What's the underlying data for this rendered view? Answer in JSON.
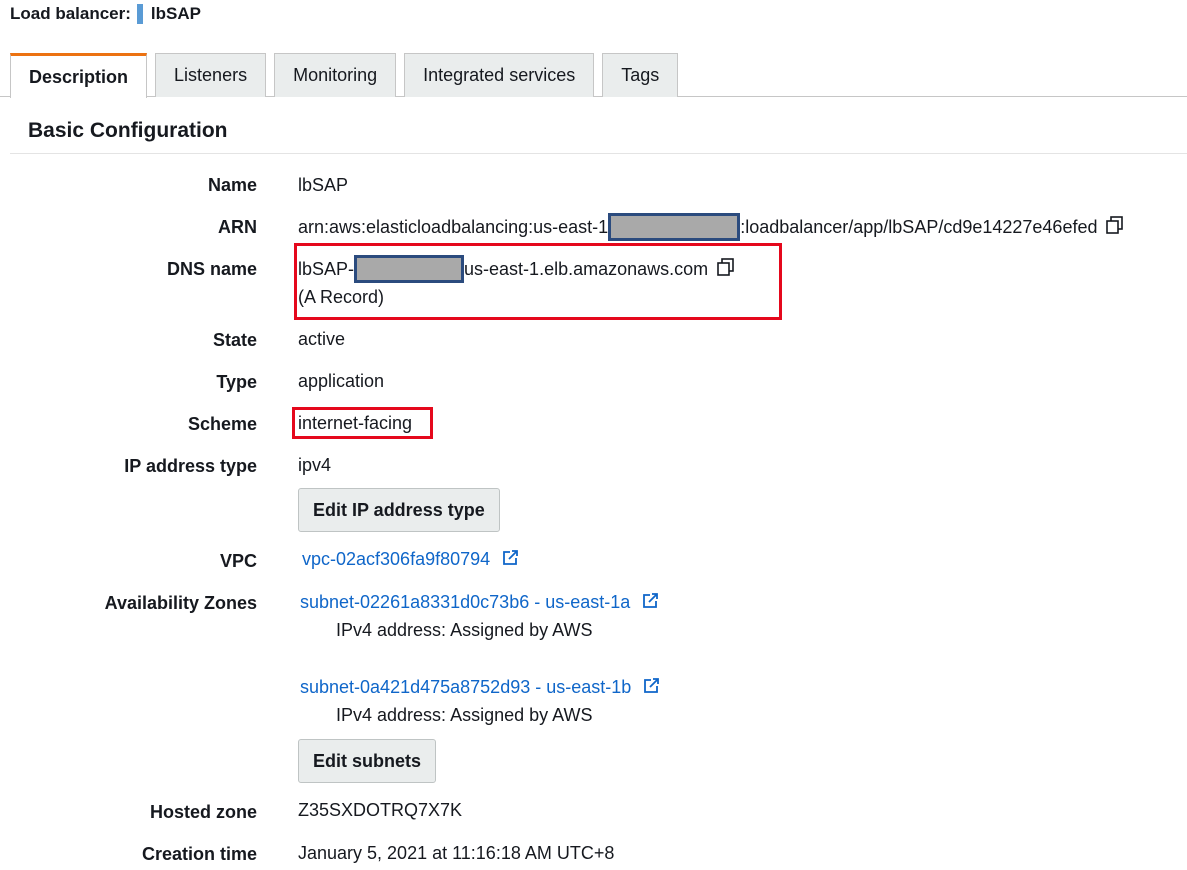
{
  "header": {
    "prefix": "Load balancer:",
    "name": "lbSAP"
  },
  "tabs": [
    "Description",
    "Listeners",
    "Monitoring",
    "Integrated services",
    "Tags"
  ],
  "section": {
    "title": "Basic Configuration"
  },
  "fields": {
    "name": {
      "label": "Name",
      "value": "lbSAP"
    },
    "arn": {
      "label": "ARN",
      "prefix": "arn:aws:elasticloadbalancing:us-east-1",
      "suffix": ":loadbalancer/app/lbSAP/cd9e14227e46efed"
    },
    "dns": {
      "label": "DNS name",
      "prefix": "lbSAP-",
      "suffix": "us-east-1.elb.amazonaws.com",
      "record": "(A Record)"
    },
    "state": {
      "label": "State",
      "value": "active"
    },
    "type": {
      "label": "Type",
      "value": "application"
    },
    "scheme": {
      "label": "Scheme",
      "value": "internet-facing"
    },
    "ip_type": {
      "label": "IP address type",
      "value": "ipv4",
      "button": "Edit IP address type"
    },
    "vpc": {
      "label": "VPC",
      "value": "vpc-02acf306fa9f80794"
    },
    "az": {
      "label": "Availability Zones",
      "subnets": [
        {
          "link": "subnet-02261a8331d0c73b6 - us-east-1a",
          "ipv4": "IPv4 address: Assigned by AWS"
        },
        {
          "link": "subnet-0a421d475a8752d93 - us-east-1b",
          "ipv4": "IPv4 address: Assigned by AWS"
        }
      ],
      "button": "Edit subnets"
    },
    "hosted_zone": {
      "label": "Hosted zone",
      "value": "Z35SXDOTRQ7X7K"
    },
    "creation_time": {
      "label": "Creation time",
      "value": "January 5, 2021 at 11:16:18 AM UTC+8"
    }
  },
  "colors": {
    "link": "#0f66c9",
    "highlight": "#e5081c",
    "redaction_border": "#2b4b7e",
    "tab_accent": "#ec7211"
  },
  "icons": {
    "copy": "copy-icon",
    "external": "external-link-icon"
  }
}
